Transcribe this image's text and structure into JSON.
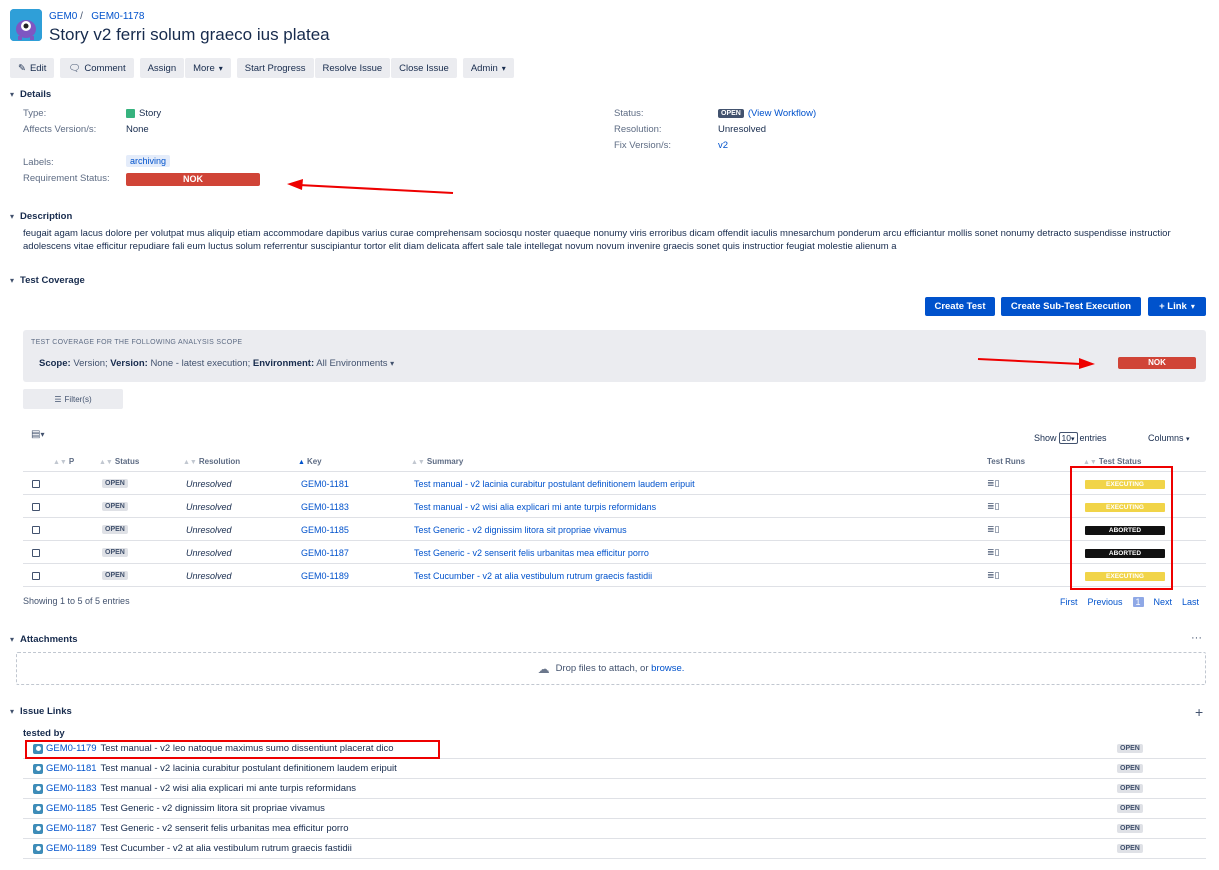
{
  "header": {
    "project": "GEM0",
    "separator": "/",
    "issue_key": "GEM0-1178",
    "title": "Story v2 ferri solum graeco ius platea"
  },
  "toolbar": {
    "edit": "Edit",
    "comment": "Comment",
    "assign": "Assign",
    "more": "More",
    "start_progress": "Start Progress",
    "resolve_issue": "Resolve Issue",
    "close_issue": "Close Issue",
    "admin": "Admin"
  },
  "details": {
    "heading": "Details",
    "type_label": "Type:",
    "type_value": "Story",
    "affects_label": "Affects Version/s:",
    "affects_value": "None",
    "labels_label": "Labels:",
    "labels_value": "archiving",
    "req_status_label": "Requirement Status:",
    "req_status_value": "NOK",
    "status_label": "Status:",
    "status_value": "OPEN",
    "view_workflow": "(View Workflow)",
    "resolution_label": "Resolution:",
    "resolution_value": "Unresolved",
    "fix_label": "Fix Version/s:",
    "fix_value": "v2"
  },
  "description": {
    "heading": "Description",
    "text": "feugait agam lacus dolore per volutpat mus aliquip etiam accommodare dapibus varius curae comprehensam sociosqu noster quaeque nonumy viris erroribus dicam offendit iaculis mnesarchum ponderum arcu efficiantur mollis sonet nonumy detracto suspendisse instructior adolescens vitae efficitur repudiare fali eum luctus solum referrentur suscipiantur tortor elit diam delicata affert sale tale intellegat novum novum invenire graecis sonet quis instructior feugiat molestie alienum a"
  },
  "coverage": {
    "heading": "Test Coverage",
    "create_test": "Create Test",
    "create_sub": "Create Sub-Test Execution",
    "link": "+ Link",
    "scope_title": "TEST COVERAGE FOR THE FOLLOWING ANALYSIS SCOPE",
    "scope_label": "Scope:",
    "scope_value": "Version;",
    "version_label": "Version:",
    "version_value": "None - latest execution;",
    "env_label": "Environment:",
    "env_value": "All Environments",
    "status": "NOK",
    "filter": "Filter(s)",
    "show": "Show",
    "entries_value": "10",
    "entries": "entries",
    "columns": "Columns",
    "columns_header": [
      "P",
      "Status",
      "Resolution",
      "Key",
      "Summary",
      "Test Runs",
      "Test Status"
    ],
    "rows": [
      {
        "status": "OPEN",
        "resolution": "Unresolved",
        "key": "GEM0-1181",
        "summary": "Test manual - v2 lacinia curabitur postulant definitionem laudem eripuit",
        "test_status": "EXECUTING"
      },
      {
        "status": "OPEN",
        "resolution": "Unresolved",
        "key": "GEM0-1183",
        "summary": "Test manual - v2 wisi alia explicari mi ante turpis reformidans",
        "test_status": "EXECUTING"
      },
      {
        "status": "OPEN",
        "resolution": "Unresolved",
        "key": "GEM0-1185",
        "summary": "Test Generic - v2 dignissim litora sit propriae vivamus",
        "test_status": "ABORTED"
      },
      {
        "status": "OPEN",
        "resolution": "Unresolved",
        "key": "GEM0-1187",
        "summary": "Test Generic - v2 senserit felis urbanitas mea efficitur porro",
        "test_status": "ABORTED"
      },
      {
        "status": "OPEN",
        "resolution": "Unresolved",
        "key": "GEM0-1189",
        "summary": "Test Cucumber - v2 at alia vestibulum rutrum graecis fastidii",
        "test_status": "EXECUTING"
      }
    ],
    "showing": "Showing 1 to 5 of 5 entries",
    "pager": {
      "first": "First",
      "previous": "Previous",
      "current": "1",
      "next": "Next",
      "last": "Last"
    }
  },
  "attachments": {
    "heading": "Attachments",
    "more": "···",
    "drop_text": "Drop files to attach, or",
    "browse": "browse."
  },
  "issue_links": {
    "heading": "Issue Links",
    "add": "+",
    "group": "tested by",
    "links": [
      {
        "key": "GEM0-1179",
        "summary": "Test manual - v2 leo natoque maximus sumo dissentiunt placerat dico",
        "status": "OPEN"
      },
      {
        "key": "GEM0-1181",
        "summary": "Test manual - v2 lacinia curabitur postulant definitionem laudem eripuit",
        "status": "OPEN"
      },
      {
        "key": "GEM0-1183",
        "summary": "Test manual - v2 wisi alia explicari mi ante turpis reformidans",
        "status": "OPEN"
      },
      {
        "key": "GEM0-1185",
        "summary": "Test Generic - v2 dignissim litora sit propriae vivamus",
        "status": "OPEN"
      },
      {
        "key": "GEM0-1187",
        "summary": "Test Generic - v2 senserit felis urbanitas mea efficitur porro",
        "status": "OPEN"
      },
      {
        "key": "GEM0-1189",
        "summary": "Test Cucumber - v2 at alia vestibulum rutrum graecis fastidii",
        "status": "OPEN"
      }
    ]
  },
  "colors": {
    "nok": "#d04437",
    "executing": "#f1d448",
    "aborted": "#111111",
    "primary": "#0052cc",
    "annotation_red": "#e00000"
  }
}
